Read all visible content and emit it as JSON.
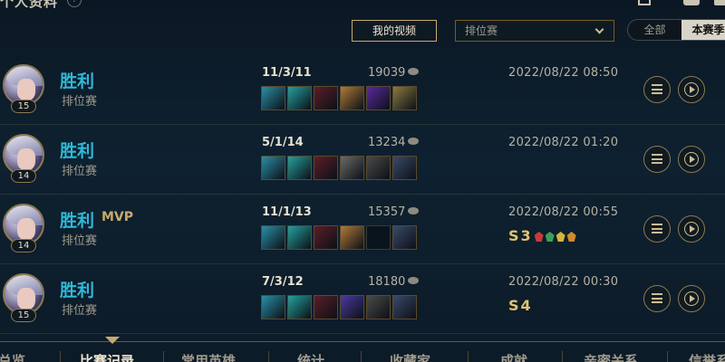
{
  "header": {
    "title": "个人资料",
    "help": "?"
  },
  "toolbar": {
    "my_videos_label": "我的视频",
    "queue_select_value": "排位赛",
    "segment": [
      "全部",
      "本赛季"
    ]
  },
  "colors": {
    "gold": "#c8aa6e",
    "victory": "#2fb8d8",
    "background": "#0e2130"
  },
  "matches": [
    {
      "result": "胜利",
      "mvp": "",
      "mode": "排位赛",
      "level": "15",
      "kda": "11/3/11",
      "gold": "19039",
      "items": [
        "#2a8fa6",
        "#24a0a0",
        "#5a1e2a",
        "#b07a3a",
        "#5a2aa0",
        "#8a7a40"
      ],
      "date": "2022/08/22 08:50",
      "season": ""
    },
    {
      "result": "胜利",
      "mvp": "",
      "mode": "排位赛",
      "level": "14",
      "kda": "5/1/14",
      "gold": "13234",
      "items": [
        "#2a8fa6",
        "#24a0a0",
        "#5a1e2a",
        "#6a6a6a",
        "#4a4a48",
        "#3a4a6a"
      ],
      "date": "2022/08/22 01:20",
      "season": ""
    },
    {
      "result": "胜利",
      "mvp": "MVP",
      "mode": "排位赛",
      "level": "14",
      "kda": "11/1/13",
      "gold": "15357",
      "items": [
        "#2a8fa6",
        "#24a0a0",
        "#5a1e2a",
        "#b07a3a",
        "",
        "#3a4a6a"
      ],
      "date": "2022/08/22 00:55",
      "season": "S3"
    },
    {
      "result": "胜利",
      "mvp": "",
      "mode": "排位赛",
      "level": "15",
      "kda": "7/3/12",
      "gold": "18180",
      "items": [
        "#2a8fa6",
        "#24a0a0",
        "#5a1e2a",
        "#4a3aa0",
        "#4a4a48",
        "#3a4a6a"
      ],
      "date": "2022/08/22 00:30",
      "season": "S4"
    }
  ],
  "bottom_nav": [
    "总览",
    "比赛记录",
    "常用英雄",
    "统计",
    "收藏家",
    "成就",
    "亲密关系",
    "信誉系"
  ]
}
